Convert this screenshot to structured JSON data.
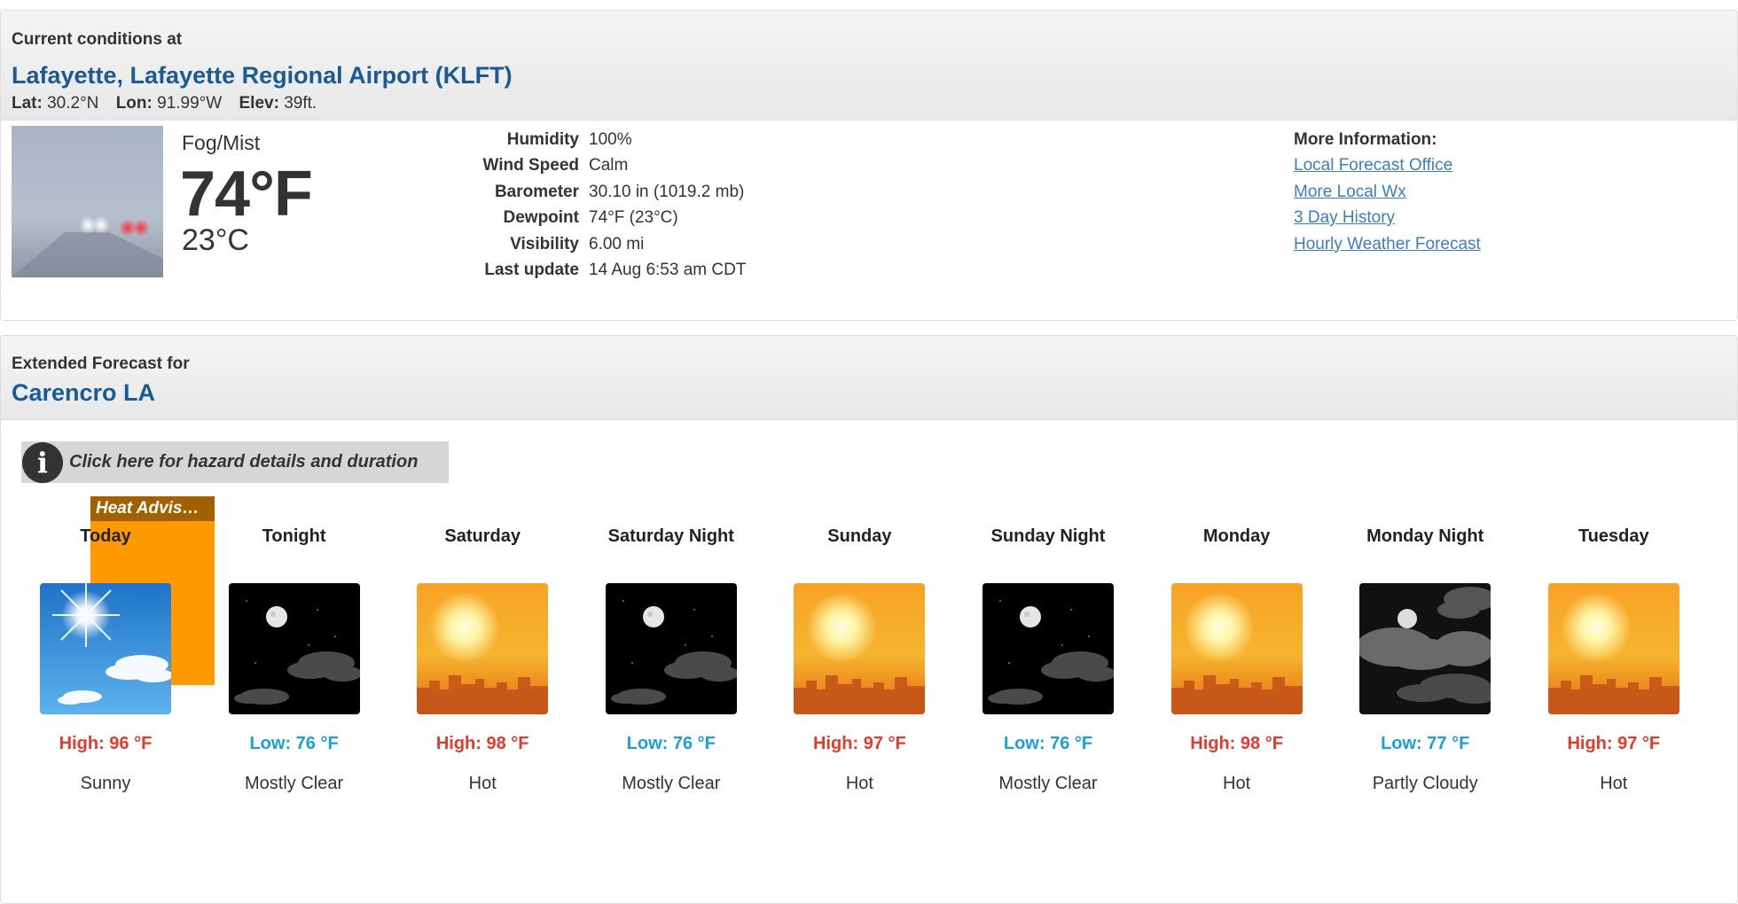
{
  "current": {
    "label": "Current conditions at",
    "station": "Lafayette, Lafayette Regional Airport (KLFT)",
    "lat_label": "Lat:",
    "lat": "30.2°N",
    "lon_label": "Lon:",
    "lon": "91.99°W",
    "elev_label": "Elev:",
    "elev": "39ft.",
    "condition": "Fog/Mist",
    "temp_f": "74°F",
    "temp_c": "23°C",
    "details": [
      {
        "label": "Humidity",
        "value": "100%"
      },
      {
        "label": "Wind Speed",
        "value": "Calm"
      },
      {
        "label": "Barometer",
        "value": "30.10 in (1019.2 mb)"
      },
      {
        "label": "Dewpoint",
        "value": "74°F (23°C)"
      },
      {
        "label": "Visibility",
        "value": "6.00 mi"
      },
      {
        "label": "Last update",
        "value": "14 Aug 6:53 am CDT"
      }
    ],
    "more_info": {
      "heading": "More Information:",
      "links": [
        "Local Forecast Office",
        "More Local Wx",
        "3 Day History",
        "Hourly Weather Forecast"
      ]
    }
  },
  "extended": {
    "label": "Extended Forecast for",
    "location": "Carencro LA",
    "hazard_text": "Click here for hazard details and duration",
    "heat_advisory": "Heat Advis…",
    "periods": [
      {
        "name": "Today",
        "icon": "sunny-icon",
        "temp": "High: 96 °F",
        "kind": "hi",
        "short": "Sunny"
      },
      {
        "name": "Tonight",
        "icon": "night-clear-icon",
        "temp": "Low: 76 °F",
        "kind": "lo",
        "short": "Mostly Clear"
      },
      {
        "name": "Saturday",
        "icon": "hot-icon",
        "temp": "High: 98 °F",
        "kind": "hi",
        "short": "Hot"
      },
      {
        "name": "Saturday Night",
        "icon": "night-clear-icon",
        "temp": "Low: 76 °F",
        "kind": "lo",
        "short": "Mostly Clear"
      },
      {
        "name": "Sunday",
        "icon": "hot-icon",
        "temp": "High: 97 °F",
        "kind": "hi",
        "short": "Hot"
      },
      {
        "name": "Sunday Night",
        "icon": "night-clear-icon",
        "temp": "Low: 76 °F",
        "kind": "lo",
        "short": "Mostly Clear"
      },
      {
        "name": "Monday",
        "icon": "hot-icon",
        "temp": "High: 98 °F",
        "kind": "hi",
        "short": "Hot"
      },
      {
        "name": "Monday Night",
        "icon": "night-partly-cloudy-icon",
        "temp": "Low: 77 °F",
        "kind": "lo",
        "short": "Partly Cloudy"
      },
      {
        "name": "Tuesday",
        "icon": "hot-icon",
        "temp": "High: 97 °F",
        "kind": "hi",
        "short": "Hot"
      }
    ]
  },
  "colors": {
    "title_blue": "#1a5a96",
    "link_blue": "#3b7dbf",
    "high_red": "#e23b2c",
    "low_blue": "#1aa0d8",
    "heat_advisory_orange": "#ff9900"
  }
}
